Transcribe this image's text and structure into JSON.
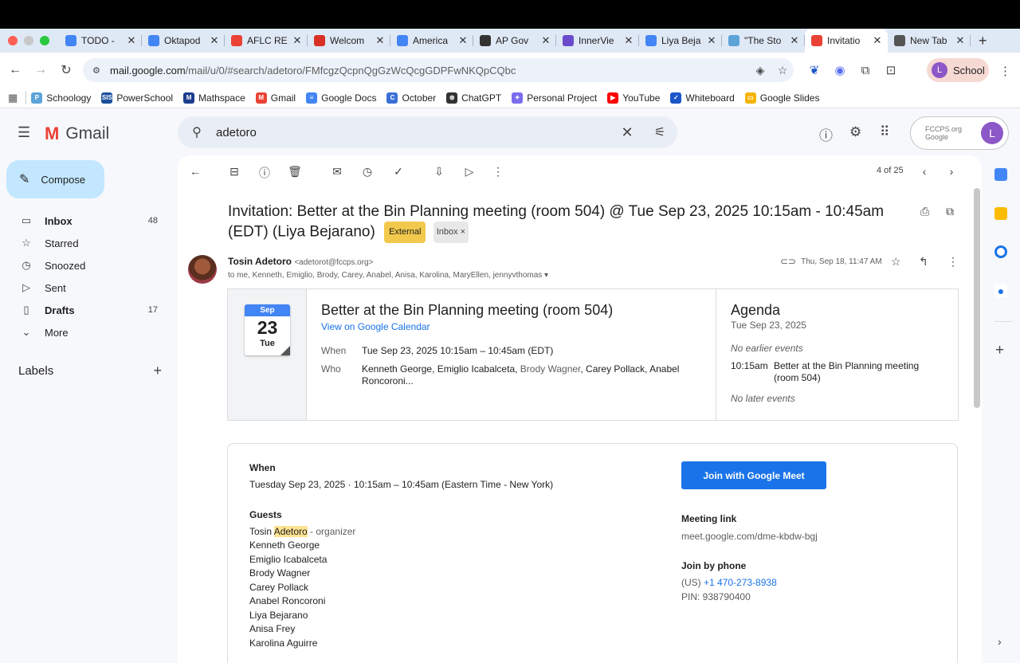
{
  "browser": {
    "tabs": [
      {
        "label": "TODO - ",
        "icon": "docs-icon",
        "color": "#4285f4"
      },
      {
        "label": "Oktapod",
        "icon": "docs-icon",
        "color": "#4285f4"
      },
      {
        "label": "AFLC RE",
        "icon": "gmail-icon",
        "color": "#ea4335"
      },
      {
        "label": "Welcom",
        "icon": "red-logo-icon",
        "color": "#d93025"
      },
      {
        "label": "America",
        "icon": "docs-icon",
        "color": "#4285f4"
      },
      {
        "label": "AP Gov",
        "icon": "chatgpt-icon",
        "color": "#333333"
      },
      {
        "label": "InnerVie",
        "icon": "purple-logo-icon",
        "color": "#6b4acb"
      },
      {
        "label": "Liya Beja",
        "icon": "docs-icon",
        "color": "#4285f4"
      },
      {
        "label": "\"The Sto",
        "icon": "schoology-icon",
        "color": "#5ba3d9"
      },
      {
        "label": "Invitatio",
        "icon": "gmail-icon",
        "color": "#ea4335",
        "active": true
      },
      {
        "label": "New Tab",
        "icon": "chrome-icon",
        "color": "#555555"
      }
    ],
    "url_domain": "mail.google.com",
    "url_path": "/mail/u/0/#search/adetoro/FMfcgzQcpnQgGzWcQcgGDPFwNKQpCQbc",
    "profile_label": "School",
    "profile_initial": "L",
    "bookmarks": [
      {
        "label": "Schoology",
        "color": "#5ba3d9",
        "glyph": "P"
      },
      {
        "label": "PowerSchool",
        "color": "#1b4f9c",
        "glyph": "SIS"
      },
      {
        "label": "Mathspace",
        "color": "#1a3d8f",
        "glyph": "M"
      },
      {
        "label": "Gmail",
        "color": "#ea4335",
        "glyph": "M"
      },
      {
        "label": "Google Docs",
        "color": "#4285f4",
        "glyph": "≡"
      },
      {
        "label": "October",
        "color": "#3b6fd8",
        "glyph": "C"
      },
      {
        "label": "ChatGPT",
        "color": "#333333",
        "glyph": "⊛"
      },
      {
        "label": "Personal Project",
        "color": "#7b6cf0",
        "glyph": "✦"
      },
      {
        "label": "YouTube",
        "color": "#ff0000",
        "glyph": "▶"
      },
      {
        "label": "Whiteboard",
        "color": "#1a56c9",
        "glyph": "✓"
      },
      {
        "label": "Google Slides",
        "color": "#f4b400",
        "glyph": "▭"
      }
    ]
  },
  "gmail": {
    "product_name": "Gmail",
    "search_value": "adetoro",
    "account_org": "FCCPS.org Google",
    "account_initial": "L",
    "compose_label": "Compose",
    "nav": [
      {
        "label": "Inbox",
        "count": "48",
        "bold": true,
        "icon": "inbox-icon"
      },
      {
        "label": "Starred",
        "count": "",
        "icon": "star-icon"
      },
      {
        "label": "Snoozed",
        "count": "",
        "icon": "clock-icon"
      },
      {
        "label": "Sent",
        "count": "",
        "icon": "send-icon"
      },
      {
        "label": "Drafts",
        "count": "17",
        "bold": true,
        "icon": "draft-icon"
      },
      {
        "label": "More",
        "count": "",
        "icon": "chevron-down-icon"
      }
    ],
    "labels_heading": "Labels",
    "pager": "4 of 25"
  },
  "email": {
    "subject": "Invitation: Better at the Bin Planning meeting (room 504) @ Tue Sep 23, 2025 10:15am - 10:45am (EDT) (Liya Bejarano)",
    "tag_external": "External",
    "tag_inbox": "Inbox ×",
    "sender_name": "Tosin Adetoro",
    "sender_email": "<adetorot@fccps.org>",
    "recipients": "to me, Kenneth, Emiglio, Brody, Carey, Anabel, Anisa, Karolina, MaryEllen, jennyvthomas ▾",
    "date": "Thu, Sep 18, 11:47 AM"
  },
  "calendar_card": {
    "month": "Sep",
    "day": "23",
    "weekday": "Tue",
    "title": "Better at the Bin Planning meeting (room 504)",
    "view_link": "View on Google Calendar",
    "when_label": "When",
    "when_value": "Tue Sep 23, 2025 10:15am – 10:45am (EDT)",
    "who_label": "Who",
    "who_value_a": "Kenneth George, Emiglio Icabalceta, ",
    "who_value_b": "Brody Wagner",
    "who_value_c": ", Carey Pollack, Anabel Roncoroni...",
    "agenda_title": "Agenda",
    "agenda_date": "Tue Sep 23, 2025",
    "no_earlier": "No earlier events",
    "event_time": "10:15am",
    "event_title": "Better at the Bin Planning meeting (room 504)",
    "no_later": "No later events"
  },
  "invite": {
    "when_heading": "When",
    "when_date": "Tuesday Sep 23, 2025",
    "when_sep": " · ",
    "when_time": "10:15am – 10:45am (Eastern Time - New York)",
    "guests_heading": "Guests",
    "organizer_first": "Tosin ",
    "organizer_last": "Adetoro",
    "organizer_role": " - organizer",
    "guests": [
      "Kenneth George",
      "Emiglio Icabalceta",
      "Brody Wagner",
      "Carey Pollack",
      "Anabel Roncoroni",
      "Liya Bejarano",
      "Anisa Frey",
      "Karolina Aguirre"
    ],
    "join_button": "Join with Google Meet",
    "meeting_link_heading": "Meeting link",
    "meeting_link": "meet.google.com/dme-kbdw-bgj",
    "phone_heading": "Join by phone",
    "phone_prefix": "(US) ",
    "phone_number": "+1 470-273-8938",
    "pin": "PIN: 938790400"
  }
}
